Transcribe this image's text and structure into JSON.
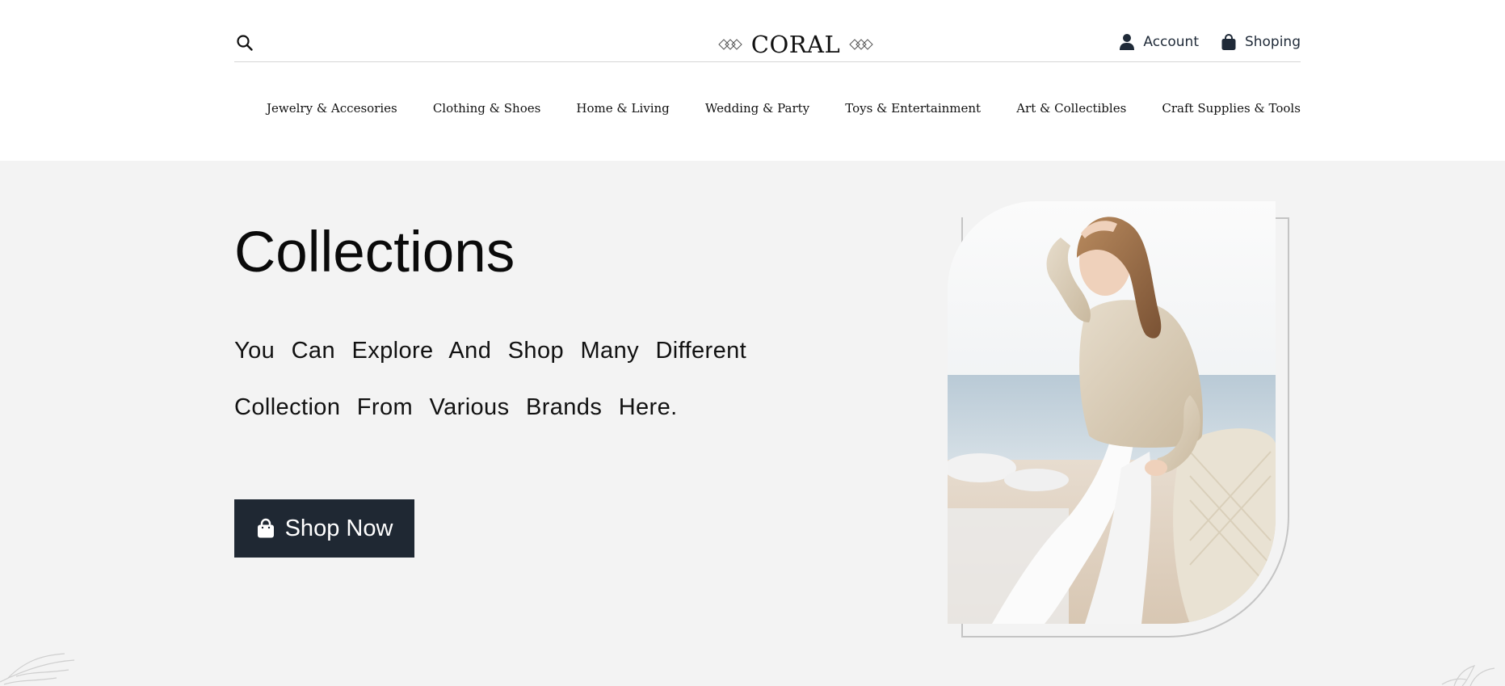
{
  "brand": {
    "name": "CORAL"
  },
  "topbar": {
    "account_label": "Account",
    "cart_label": "Shoping"
  },
  "nav": {
    "items": [
      {
        "label": "Jewelry & Accesories"
      },
      {
        "label": "Clothing & Shoes"
      },
      {
        "label": "Home & Living"
      },
      {
        "label": "Wedding & Party"
      },
      {
        "label": "Toys & Entertainment"
      },
      {
        "label": "Art & Collectibles"
      },
      {
        "label": "Craft Supplies & Tools"
      }
    ]
  },
  "hero": {
    "title": "Collections",
    "subtitle": "You Can Explore And Shop Many Different Collection From Various Brands Here.",
    "cta_label": "Shop Now"
  },
  "colors": {
    "page_bg": "#ffffff",
    "hero_bg": "#f3f3f3",
    "button_bg": "#1f2833",
    "button_text": "#ffffff",
    "icon": "#1f2a38",
    "frame_outline": "#c4c4c4"
  },
  "icons": {
    "search": "search-icon",
    "account": "user-icon",
    "cart": "shopping-bag-icon",
    "cta": "shopping-bag-icon"
  }
}
